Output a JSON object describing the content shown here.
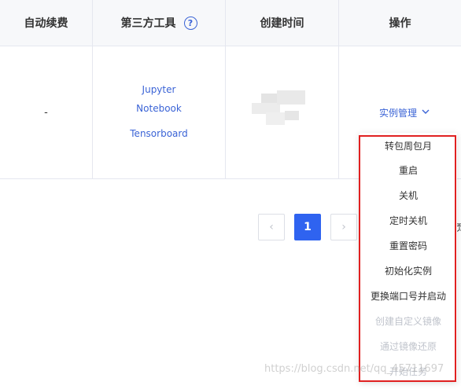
{
  "table": {
    "headers": {
      "auto_renew": "自动续费",
      "third_party_tools": "第三方工具",
      "created_time": "创建时间",
      "actions": "操作"
    },
    "row": {
      "auto_renew": "-",
      "tools": [
        "Jupyter",
        "Notebook",
        "Tensorboard"
      ],
      "action_label": "实例管理"
    }
  },
  "pagination": {
    "current_page": "1",
    "prev_symbol": "‹",
    "next_symbol": "›",
    "edge_text": "页"
  },
  "menu": {
    "items": [
      {
        "label": "转包周包月",
        "disabled": false
      },
      {
        "label": "重启",
        "disabled": false
      },
      {
        "label": "关机",
        "disabled": false
      },
      {
        "label": "定时关机",
        "disabled": false
      },
      {
        "label": "重置密码",
        "disabled": false
      },
      {
        "label": "初始化实例",
        "disabled": false
      },
      {
        "label": "更换端口号并启动",
        "disabled": false
      },
      {
        "label": "创建自定义镜像",
        "disabled": true
      },
      {
        "label": "通过镜像还原",
        "disabled": true
      },
      {
        "label": "开始任务",
        "disabled": true
      }
    ]
  },
  "watermark": "https://blog.csdn.net/qq_45711697",
  "colors": {
    "accent": "#3a63d6",
    "active_page": "#2f63f0",
    "highlight_outline": "#e02020",
    "disabled": "#c0c4cc"
  },
  "icons": {
    "help": "question-circle-icon",
    "chevron": "chevron-down-icon",
    "prev": "chevron-left-icon",
    "next": "chevron-right-icon"
  }
}
